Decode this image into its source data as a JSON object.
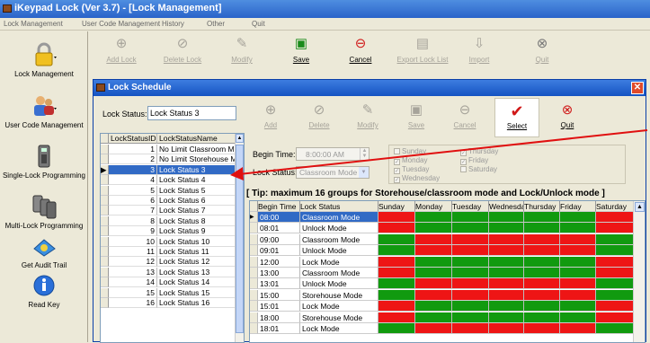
{
  "window": {
    "title": "iKeypad Lock (Ver 3.7) - [Lock Management]"
  },
  "menu": [
    "Lock Management",
    "User Code Management",
    "History",
    "Other",
    "Quit"
  ],
  "sidebar": [
    {
      "label": "Lock Management",
      "icon": "padlock-icon"
    },
    {
      "label": "User Code Management",
      "icon": "users-icon"
    },
    {
      "label": "Single-Lock Programming",
      "icon": "keypad-icon"
    },
    {
      "label": "Multi-Lock Programming",
      "icon": "multi-keypad-icon"
    },
    {
      "label": "Get Audit Trail",
      "icon": "audit-icon"
    },
    {
      "label": "Read Key",
      "icon": "info-icon"
    }
  ],
  "toolbar": {
    "add": "Add Lock",
    "delete": "Delete Lock",
    "modify": "Modify",
    "save": "Save",
    "cancel": "Cancel",
    "export": "Export Lock List",
    "import": "Import",
    "quit": "Quit"
  },
  "dialog": {
    "title": "Lock Schedule",
    "lock_status_label": "Lock Status:",
    "lock_status_value": "Lock Status 3",
    "buttons": {
      "add": "Add",
      "delete": "Delete",
      "modify": "Modify",
      "save": "Save",
      "cancel": "Cancel",
      "select": "Select",
      "quit": "Quit"
    },
    "list_headers": {
      "id": "LockStatusID",
      "name": "LockStatusName"
    },
    "list": [
      {
        "id": "1",
        "name": "No Limit Classroom Mode"
      },
      {
        "id": "2",
        "name": "No Limit Storehouse Mode"
      },
      {
        "id": "3",
        "name": "Lock Status 3"
      },
      {
        "id": "4",
        "name": "Lock Status 4"
      },
      {
        "id": "5",
        "name": "Lock Status 5"
      },
      {
        "id": "6",
        "name": "Lock Status 6"
      },
      {
        "id": "7",
        "name": "Lock Status 7"
      },
      {
        "id": "8",
        "name": "Lock Status 8"
      },
      {
        "id": "9",
        "name": "Lock Status 9"
      },
      {
        "id": "10",
        "name": "Lock Status 10"
      },
      {
        "id": "11",
        "name": "Lock Status 11"
      },
      {
        "id": "12",
        "name": "Lock Status 12"
      },
      {
        "id": "13",
        "name": "Lock Status 13"
      },
      {
        "id": "14",
        "name": "Lock Status 14"
      },
      {
        "id": "15",
        "name": "Lock Status 15"
      },
      {
        "id": "16",
        "name": "Lock Status 16"
      }
    ],
    "begin_time_label": "Begin Time:",
    "begin_time_value": "8:00:00 AM",
    "status_label": "Lock Status:",
    "status_value": "Classroom Mode",
    "days": {
      "sunday": "Sunday",
      "monday": "Monday",
      "tuesday": "Tuesday",
      "wednesday": "Wednesday",
      "thursday": "Thursday",
      "friday": "Friday",
      "saturday": "Saturday"
    },
    "tip": "[ Tip: maximum 16 groups for Storehouse/classroom mode and Lock/Unlock mode ]",
    "schedule_headers": [
      "Begin Time",
      "Lock Status",
      "Sunday",
      "Monday",
      "Tuesday",
      "Wednesday",
      "Thursday",
      "Friday",
      "Saturday"
    ],
    "schedule": [
      {
        "time": "08:00",
        "status": "Classroom Mode",
        "days": "rgggggr"
      },
      {
        "time": "08:01",
        "status": "Unlock Mode",
        "days": "rgggggr"
      },
      {
        "time": "09:00",
        "status": "Classroom Mode",
        "days": "grrrrrg"
      },
      {
        "time": "09:01",
        "status": "Unlock Mode",
        "days": "grrrrrg"
      },
      {
        "time": "12:00",
        "status": "Lock Mode",
        "days": "rgggggr"
      },
      {
        "time": "13:00",
        "status": "Classroom Mode",
        "days": "rgggggr"
      },
      {
        "time": "13:01",
        "status": "Unlock Mode",
        "days": "grrrrrg"
      },
      {
        "time": "15:00",
        "status": "Storehouse Mode",
        "days": "grrrrrg"
      },
      {
        "time": "15:01",
        "status": "Lock Mode",
        "days": "rgggggr"
      },
      {
        "time": "18:00",
        "status": "Storehouse Mode",
        "days": "rgggggr"
      },
      {
        "time": "18:01",
        "status": "Lock Mode",
        "days": "grrrrrg"
      }
    ]
  },
  "colors": {
    "active": "#119a0f",
    "inactive": "#ee1515",
    "selection": "#316ac5"
  }
}
